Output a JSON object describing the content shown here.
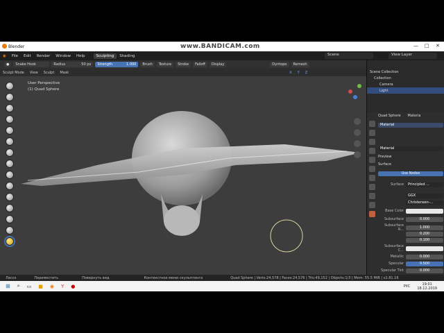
{
  "watermark": "www.BANDICAM.com",
  "window": {
    "title": "Blender",
    "min": "—",
    "max": "□",
    "close": "✕"
  },
  "menubar": {
    "items": [
      "File",
      "Edit",
      "Render",
      "Window",
      "Help"
    ],
    "tabs": [
      "Sculpting",
      "Shading"
    ],
    "scene": "Scene",
    "view_layer": "View Layer"
  },
  "tool_header": {
    "brush_name": "Snake Hook",
    "radius_label": "Radius",
    "radius_value": "50 px",
    "strength_label": "Strength",
    "strength_value": "1.000",
    "menus": [
      "Brush",
      "Texture",
      "Stroke",
      "Falloff",
      "Display"
    ],
    "dyntopo": "Dyntopo",
    "remesh": "Remesh"
  },
  "header2": {
    "mode": "Sculpt Mode",
    "items": [
      "View",
      "Sculpt",
      "Mask"
    ]
  },
  "viewport": {
    "perspective": "User Perspective",
    "object": "(1) Quad Sphere"
  },
  "outliner": {
    "title": "Scene Collection",
    "items": [
      "Collection",
      "Camera",
      "Light"
    ]
  },
  "properties": {
    "object_name": "Quad Sphere",
    "tab": "Materia",
    "material_slot": "Material",
    "material_name": "Material",
    "preview": "Preview",
    "surface": "Surface",
    "use_nodes": "Use Nodes",
    "surface_label": "Surface",
    "surface_value": "Principled ...",
    "dist": "GGX",
    "sss_method": "Christensen-...",
    "base_color": "Base Color",
    "subsurface": "Subsurface",
    "subsurface_value": "0.000",
    "subsurface_r": "Subsurface R...",
    "sr1": "1.000",
    "sr2": "0.200",
    "sr3": "0.100",
    "subsurface_c": "Subsurface C...",
    "metallic": "Metallic",
    "metallic_value": "0.000",
    "specular": "Specular",
    "specular_value": "0.500",
    "specular_tint": "Specular Tint",
    "specular_tint_value": "0.000"
  },
  "statusbar": {
    "select": "Лассо",
    "move": "Переместить",
    "rotate": "Повернуть вид",
    "context": "Контекстное меню скульптинга",
    "stats": "Quad Sphere | Verts:24,578 | Faces:24,576 | Tris:49,152 | Objects:1/3 | Mem: 55.5 MiB | v2.81.16"
  },
  "taskbar": {
    "lang": "РУС",
    "time": "19:01",
    "date": "18.12.2019"
  }
}
